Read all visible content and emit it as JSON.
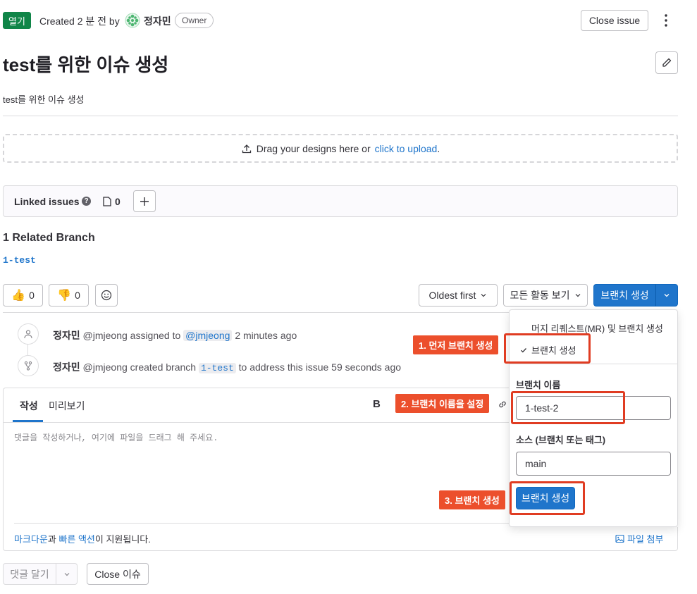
{
  "header": {
    "status_badge": "열기",
    "created_text": "Created 2 분 전 by",
    "author": "정자민",
    "role_badge": "Owner",
    "close_issue_label": "Close issue"
  },
  "issue": {
    "title": "test를 위한 이슈 생성",
    "description": "test를 위한 이슈 생성"
  },
  "design_upload": {
    "prompt": "Drag your designs here or",
    "link": "click to upload",
    "suffix": "."
  },
  "linked_issues": {
    "label": "Linked issues",
    "count": "0"
  },
  "related_branches": {
    "heading": "1 Related Branch",
    "branch": "1-test"
  },
  "reactions": {
    "thumbs_up_count": "0",
    "thumbs_down_count": "0"
  },
  "activity_controls": {
    "sort_label": "Oldest first",
    "filter_label": "모든 활동 보기",
    "create_branch_label": "브랜치 생성"
  },
  "activity": [
    {
      "author": "정자민",
      "handle": "@jmjeong assigned to",
      "mention": "@jmjeong",
      "time": "2 minutes ago"
    },
    {
      "author": "정자민",
      "handle": "@jmjeong created branch",
      "branch": "1-test",
      "rest": "to address this issue 59 seconds ago"
    }
  ],
  "comment_editor": {
    "tab_write": "작성",
    "tab_preview": "미리보기",
    "bold_label": "B",
    "placeholder": "댓글을 작성하거나, 여기에 파일을 드래그 해 주세요.",
    "markdown_link": "마크다운",
    "and_text": "과",
    "quick_actions_link": "빠른 액션",
    "supported_text": "이 지원됩니다.",
    "attach_label": "파일 첨부"
  },
  "footer_actions": {
    "comment_label": "댓글 달기",
    "close_issue_label": "Close 이슈"
  },
  "branch_dropdown": {
    "option_mr": "머지 리퀘스트(MR) 및 브랜치 생성",
    "option_branch": "브랜치 생성",
    "branch_name_label": "브랜치 이름",
    "branch_name_value": "1-test-2",
    "source_label": "소스 (브랜치 또는 태그)",
    "source_value": "main",
    "submit_label": "브랜치 생성"
  },
  "callouts": {
    "step1": "1. 먼저 브랜치 생성",
    "step2": "2. 브랜치 이름을 설정",
    "step3": "3. 브랜치 생성"
  },
  "colors": {
    "accent": "#1f75cb",
    "status_open": "#108548",
    "callout": "#ec4f2c"
  }
}
